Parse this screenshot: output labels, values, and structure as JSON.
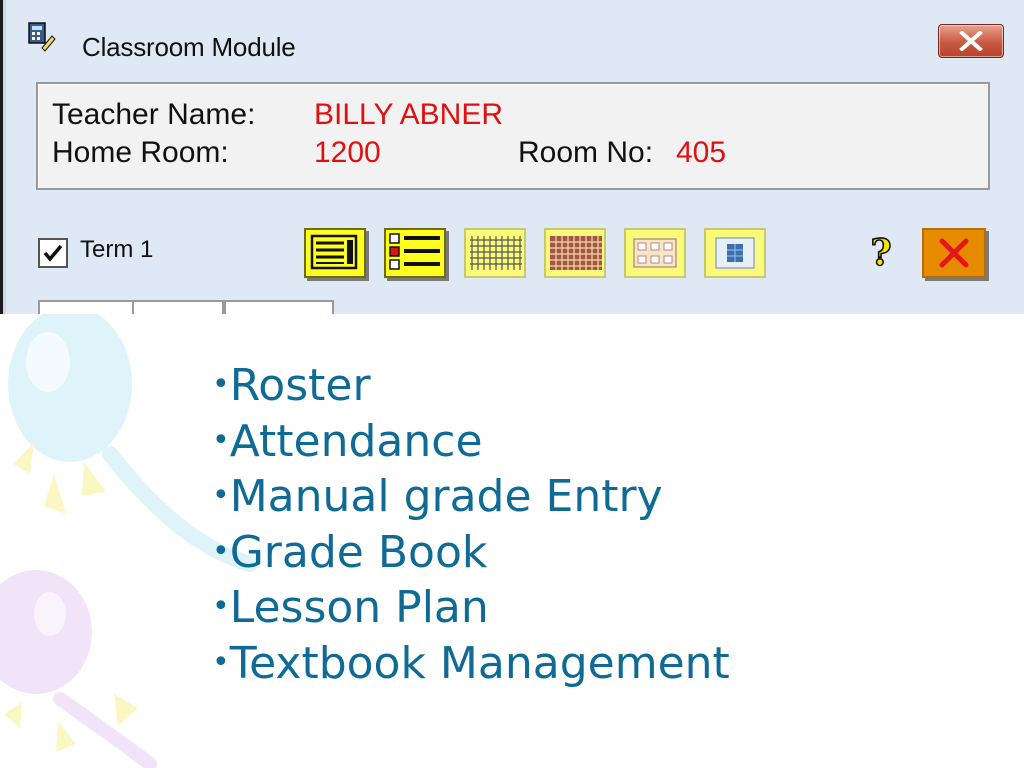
{
  "window": {
    "title": "Classroom Module",
    "teacher_label": "Teacher Name:",
    "teacher_value": "BILLY ABNER",
    "homeroom_label": "Home Room:",
    "homeroom_value": "1200",
    "room_label": "Room No:",
    "room_value": "405",
    "term_label": "Term 1",
    "term_checked": true,
    "toolbar_icons": [
      "roster-icon",
      "attendance-list-icon",
      "grid-icon",
      "gradebook-icon",
      "lesson-plan-icon",
      "textbook-icon"
    ],
    "help_icon": "question-mark-icon",
    "exit_icon": "red-x-icon"
  },
  "slide": {
    "bullet": "•",
    "items": [
      "Roster",
      "Attendance",
      "Manual grade Entry",
      "Grade Book",
      "Lesson Plan",
      "Textbook Management"
    ]
  },
  "colors": {
    "accent_red": "#e01010",
    "bullet_text": "#0f6b96",
    "tool_yellow": "#ffff1f",
    "exit_orange": "#e68a00"
  }
}
